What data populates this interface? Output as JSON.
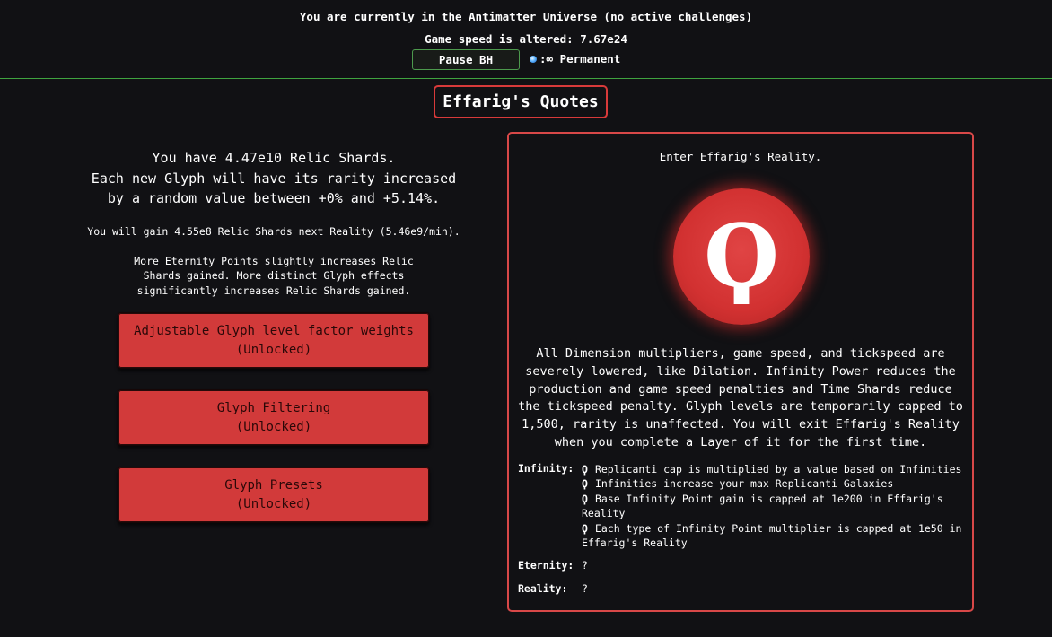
{
  "header": {
    "universe_text": "You are currently in the Antimatter Universe (no active challenges)",
    "speed_text": "Game speed is altered: 7.67e24",
    "pause_bh_label": "Pause BH",
    "bh_status": ":∞ Permanent"
  },
  "title": "Effarig's Quotes",
  "left": {
    "shard_line1": "You have 4.47e10 Relic Shards.",
    "shard_line2": "Each new Glyph will have its rarity increased",
    "shard_line3": "by a random value between +0% and +5.14%.",
    "gain_text": "You will gain 4.55e8 Relic Shards next Reality (5.46e9/min).",
    "explain_text": "More Eternity Points slightly increases Relic Shards gained. More distinct Glyph effects significantly increases Relic Shards gained.",
    "buttons": [
      {
        "label": "Adjustable Glyph level factor weights",
        "status": "(Unlocked)"
      },
      {
        "label": "Glyph Filtering",
        "status": "(Unlocked)"
      },
      {
        "label": "Glyph Presets",
        "status": "(Unlocked)"
      }
    ]
  },
  "reality_panel": {
    "enter_text": "Enter Effarig's Reality.",
    "symbol": "Ϙ",
    "description": "All Dimension multipliers, game speed, and tickspeed are severely lowered, like Dilation. Infinity Power reduces the production and game speed penalties and Time Shards reduce the tickspeed penalty. Glyph levels are temporarily capped to 1,500, rarity is unaffected. You will exit Effarig's Reality when you complete a Layer of it for the first time.",
    "rewards": {
      "infinity_label": "Infinity:",
      "infinity_items": [
        "Replicanti cap is multiplied by a value based on Infinities",
        "Infinities increase your max Replicanti Galaxies",
        "Base Infinity Point gain is capped at 1e200 in Effarig's Reality",
        "Each type of Infinity Point multiplier is capped at 1e50 in Effarig's Reality"
      ],
      "item_symbol": "Ϙ",
      "eternity_label": "Eternity:",
      "eternity_value": "?",
      "reality_label": "Reality:",
      "reality_value": "?"
    }
  },
  "colors": {
    "accent_red": "#d23a3a",
    "panel_border": "#d84848",
    "header_line": "#3fa33f",
    "bh_icon": "#5cb3ff"
  }
}
